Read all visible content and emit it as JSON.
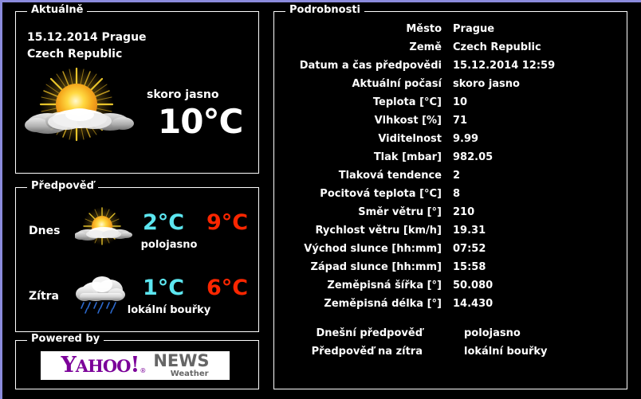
{
  "current": {
    "legend": "Aktuálně",
    "date_location_line1": "15.12.2014 Prague",
    "date_location_line2": "Czech Republic",
    "condition": "skoro jasno",
    "temperature": "10°C",
    "icon": "sun-behind-cloud-icon"
  },
  "forecast": {
    "legend": "Předpověď",
    "rows": [
      {
        "day": "Dnes",
        "icon": "sun-behind-cloud-icon",
        "low": "2°C",
        "high": "9°C",
        "text": "polojasno"
      },
      {
        "day": "Zítra",
        "icon": "rain-cloud-icon",
        "low": "1°C",
        "high": "6°C",
        "text": "lokální bouřky"
      }
    ]
  },
  "powered": {
    "legend": "Powered by",
    "logo_yahoo": "Y",
    "logo_yahoo_rest": "AHOO",
    "logo_bang": "!",
    "logo_reg": "®",
    "logo_news": "NEWS",
    "logo_weather": "Weather"
  },
  "details": {
    "legend": "Podrobnosti",
    "rows": [
      {
        "label": "Město",
        "value": "Prague"
      },
      {
        "label": "Země",
        "value": "Czech Republic"
      },
      {
        "label": "Datum a čas předpovědi",
        "value": "15.12.2014 12:59"
      },
      {
        "label": "Aktuální počasí",
        "value": "skoro jasno"
      },
      {
        "label": "Teplota [°C]",
        "value": "10"
      },
      {
        "label": "Vlhkost [%]",
        "value": "71"
      },
      {
        "label": "Viditelnost",
        "value": "9.99"
      },
      {
        "label": "Tlak [mbar]",
        "value": "982.05"
      },
      {
        "label": "Tlaková tendence",
        "value": "2"
      },
      {
        "label": "Pocitová teplota [°C]",
        "value": "8"
      },
      {
        "label": "Směr větru [°]",
        "value": "210"
      },
      {
        "label": "Rychlost větru [km/h]",
        "value": "19.31"
      },
      {
        "label": "Východ slunce [hh:mm]",
        "value": "07:52"
      },
      {
        "label": "Západ slunce [hh:mm]",
        "value": "15:58"
      },
      {
        "label": "Zeměpisná šířka [°]",
        "value": "50.080"
      },
      {
        "label": "Zeměpisná délka [°]",
        "value": "14.430"
      }
    ],
    "summary_rows": [
      {
        "label": "Dnešní předpověď",
        "value": "polojasno"
      },
      {
        "label": "Předpověď na zítra",
        "value": "lokální bouřky"
      }
    ]
  },
  "colors": {
    "background": "#000000",
    "border": "#ffffff",
    "text": "#ffffff",
    "low_temp": "#5ce6f0",
    "high_temp": "#fa2600",
    "frame": "#8b8bdc",
    "yahoo_purple": "#7b0099",
    "news_grey": "#666666"
  }
}
